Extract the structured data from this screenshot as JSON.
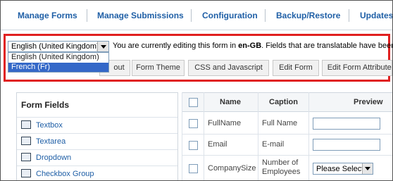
{
  "nav": {
    "items": [
      "Manage Forms",
      "Manage Submissions",
      "Configuration",
      "Backup/Restore",
      "Updates"
    ]
  },
  "language": {
    "selected": "English (United Kingdom)",
    "options": [
      "English (United Kingdom)",
      "French (Fr)"
    ],
    "highlighted": "French (Fr)"
  },
  "notice": {
    "prefix": "You are currently editing this form in ",
    "lang_code": "en-GB",
    "suffix": ". Fields that are translatable have been"
  },
  "tabs": [
    "out",
    "Form Theme",
    "CSS and Javascript",
    "Edit Form",
    "Edit Form Attributes"
  ],
  "form_fields": {
    "title": "Form Fields",
    "items": [
      {
        "label": "Textbox",
        "icon": "textbox-icon"
      },
      {
        "label": "Textarea",
        "icon": "textarea-icon"
      },
      {
        "label": "Dropdown",
        "icon": "dropdown-icon"
      },
      {
        "label": "Checkbox Group",
        "icon": "checkbox-group-icon"
      }
    ]
  },
  "table": {
    "headers": {
      "name": "Name",
      "caption": "Caption",
      "preview": "Preview"
    },
    "rows": [
      {
        "name": "FullName",
        "caption": "Full Name",
        "preview_type": "text"
      },
      {
        "name": "Email",
        "caption": "E-mail",
        "preview_type": "text"
      },
      {
        "name": "CompanySize",
        "caption": "Number of Employees",
        "caption_line1": "Number of",
        "caption_line2": "Employees",
        "preview_type": "select",
        "preview_value": "Please Select"
      }
    ]
  },
  "colors": {
    "highlight_box": "#e02020",
    "link": "#1f5fa6",
    "selected_option": "#3468c8"
  }
}
